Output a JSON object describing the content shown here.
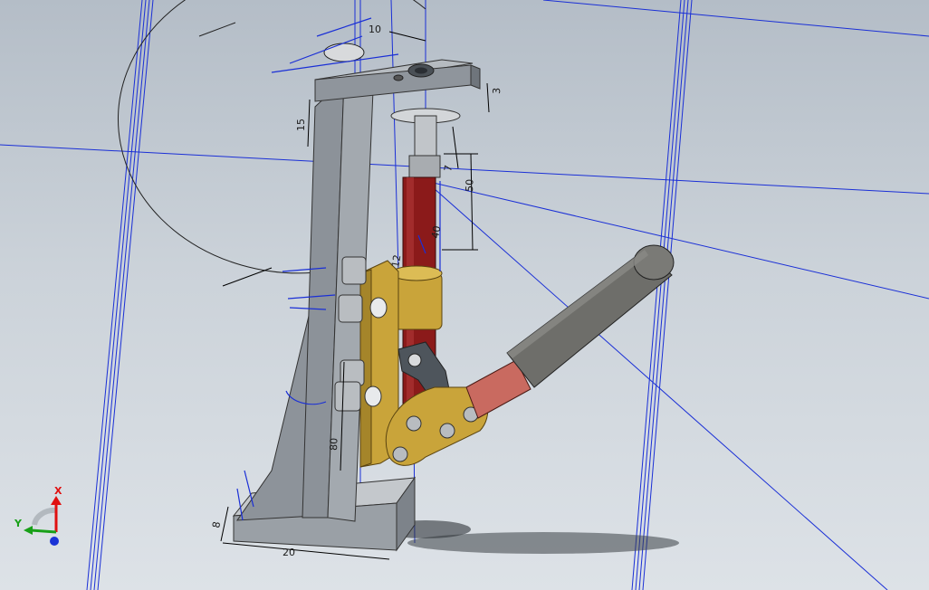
{
  "viewport": {
    "background_top": "#b4bdc7",
    "background_bottom": "#dde2e7"
  },
  "colors": {
    "construction_line": "#1a2fd6",
    "dimension_line": "#000000",
    "frame_gray": "#8f959c",
    "frame_dark": "#6b7178",
    "brass_bracket": "#c9a43a",
    "rod_red": "#8b1a1a",
    "handle_gray": "#6e6e6a",
    "handle_sleeve": "#c96a60",
    "link_dark": "#4e555c",
    "axis_x": "#e01010",
    "axis_y": "#18a018",
    "axis_z": "#1a33d6"
  },
  "model": {
    "parts": [
      "base-plate",
      "vertical-column",
      "gusset",
      "top-plate",
      "plunger-rod",
      "guide-bushing",
      "mount-bracket",
      "clamp-link",
      "clamp-handle",
      "handle-grip"
    ]
  },
  "dimensions": {
    "d10": "10",
    "d3": "3",
    "d15": "15",
    "d7": "7",
    "d50": "50",
    "d40": "40",
    "d12": "12",
    "d80": "80",
    "d8": "8",
    "d20": "20"
  },
  "triad": {
    "x_label": "X",
    "y_label": "Y"
  }
}
